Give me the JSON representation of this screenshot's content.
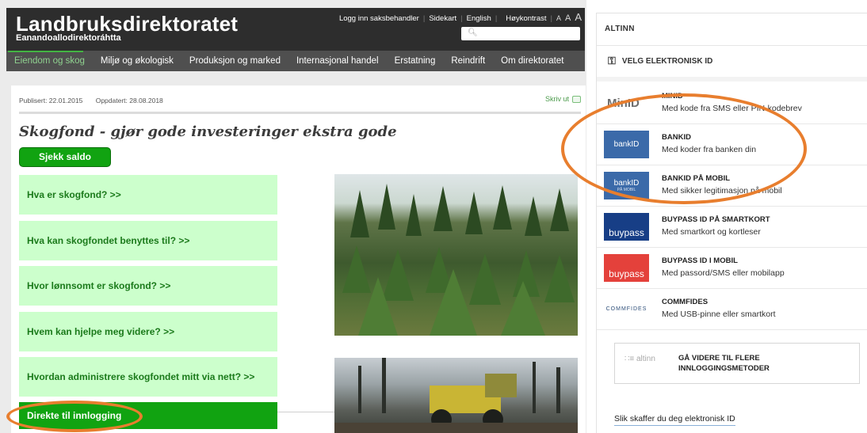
{
  "site": {
    "name": "Landbruksdirektoratet",
    "name_sami": "Eanandoallodirektoráhtta",
    "top_links": [
      "Logg inn saksbehandler",
      "Sidekart",
      "English",
      "Høykontrast"
    ],
    "font_size_labels": [
      "A",
      "A",
      "A"
    ],
    "nav": [
      "Eiendom og skog",
      "Miljø og økologisk",
      "Produksjon og marked",
      "Internasjonal handel",
      "Erstatning",
      "Reindrift",
      "Om direktoratet"
    ],
    "active_nav": "Eiendom og skog"
  },
  "article": {
    "published": "Publisert: 22.01.2015",
    "updated": "Oppdatert: 28.08.2018",
    "print_label": "Skriv ut",
    "title": "Skogfond - gjør gode investeringer ekstra gode",
    "saldo_button": "Sjekk saldo",
    "faq": [
      "Hva er skogfond? >>",
      "Hva kan skogfondet benyttes til? >>",
      "Hvor lønnsomt er skogfond? >>",
      "Hvem kan hjelpe meg videre? >>",
      "Hvordan administrere skogfondet mitt via nett? >>"
    ],
    "direct_login": "Direkte til innlogging"
  },
  "altinn": {
    "header": "ALTINN",
    "choose_title": "VELG ELEKTRONISK ID",
    "providers": [
      {
        "logo": "MinID",
        "name": "MINID",
        "desc": "Med kode fra SMS eller PIN-kodebrev"
      },
      {
        "logo": "bankID",
        "name": "BANKID",
        "desc": "Med koder fra banken din"
      },
      {
        "logo": "bankID",
        "logo_sub": "PÅ MOBIL",
        "name": "BANKID PÅ MOBIL",
        "desc": "Med sikker legitimasjon på mobil"
      },
      {
        "logo": "buypass",
        "name": "BUYPASS ID PÅ SMARTKORT",
        "desc": "Med smartkort og kortleser"
      },
      {
        "logo": "buypass",
        "name": "BUYPASS ID I MOBIL",
        "desc": "Med passord/SMS eller mobilapp"
      },
      {
        "logo": "COMMFIDES",
        "name": "COMMFIDES",
        "desc": "Med USB-pinne eller smartkort"
      }
    ],
    "more_logo": "altinn",
    "more_text": "GÅ VIDERE TIL FLERE INNLOGGINGSMETODER",
    "howto_link": "Slik skaffer du deg elektronisk ID"
  },
  "colors": {
    "annotation": "#e87e2e",
    "accent_green": "#11a311",
    "faq_bg": "#ccffcc",
    "bankid_blue": "#3b6aa9"
  }
}
